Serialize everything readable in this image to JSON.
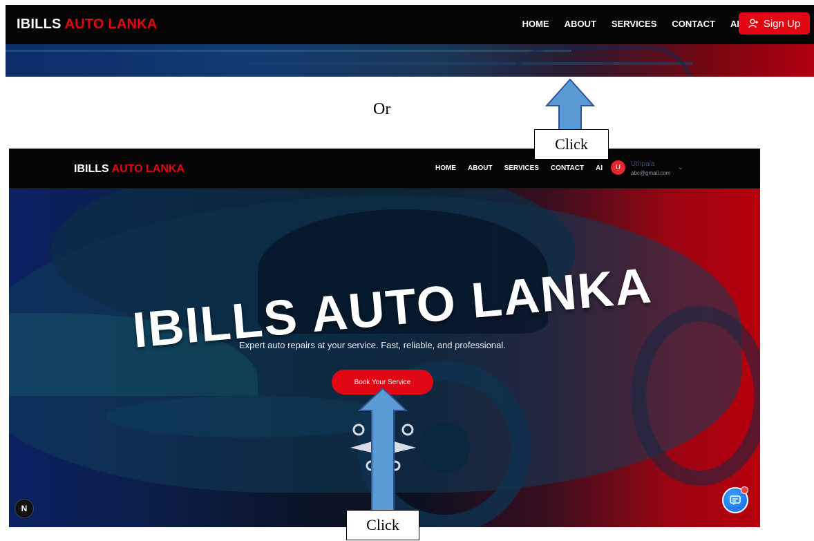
{
  "top_screenshot": {
    "brand_white": "IBILLS",
    "brand_red": "AUTO LANKA",
    "menu": [
      "HOME",
      "ABOUT",
      "SERVICES",
      "CONTACT",
      "AI"
    ],
    "signup_label": "Sign Up"
  },
  "separator": {
    "text": "Or"
  },
  "annotations": {
    "click_top": "Click",
    "click_bottom": "Click"
  },
  "main_screenshot": {
    "brand_white": "IBILLS",
    "brand_red": "AUTO LANKA",
    "menu": [
      "HOME",
      "ABOUT",
      "SERVICES",
      "CONTACT",
      "AI"
    ],
    "user": {
      "initial": "U",
      "name": "Uthpala",
      "email": "abc@gmail.com"
    },
    "hero": {
      "title": "IBILLS AUTO LANKA",
      "tagline": "Expert auto repairs at your service. Fast, reliable, and professional.",
      "button_label": "Book Your Service"
    },
    "badge_letter": "N"
  },
  "colors": {
    "accent_red": "#e30613",
    "nav_bg": "#050505",
    "arrow_fill": "#5b9bd5",
    "arrow_stroke": "#2f5597"
  }
}
